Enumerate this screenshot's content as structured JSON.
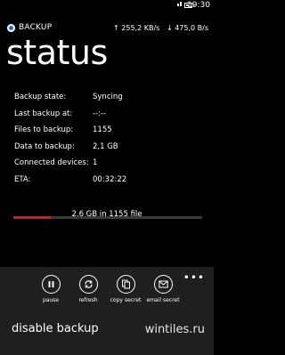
{
  "status_bar": {
    "time": "19:30",
    "battery_level": 0.6
  },
  "app": {
    "name": "BACKUP",
    "upload_speed": "↑ 255,2 KB/s",
    "download_speed": "↓ 475,0 B/s",
    "icon_color": "#1e6fd6"
  },
  "page": {
    "title": "status"
  },
  "info": {
    "rows": [
      {
        "label": "Backup state:",
        "value": "Syncing"
      },
      {
        "label": "Last backup at:",
        "value": "--:--"
      },
      {
        "label": "Files to backup:",
        "value": "1155"
      },
      {
        "label": "Data to backup:",
        "value": "2,1 GB"
      },
      {
        "label": "Connected devices:",
        "value": "1"
      },
      {
        "label": "ETA:",
        "value": "00:32:22"
      }
    ]
  },
  "progress": {
    "fraction": 0.2,
    "text": "2.6 GB in 1155 file",
    "color": "#e3141a"
  },
  "appbar": {
    "more": "•••",
    "buttons": [
      {
        "label": "pause",
        "icon": "pause-icon"
      },
      {
        "label": "refresh",
        "icon": "refresh-icon"
      },
      {
        "label": "copy secret",
        "icon": "copy-icon"
      },
      {
        "label": "email secret",
        "icon": "email-icon"
      }
    ]
  },
  "menu": {
    "item": "disable backup"
  },
  "watermark": "wintiles.ru"
}
